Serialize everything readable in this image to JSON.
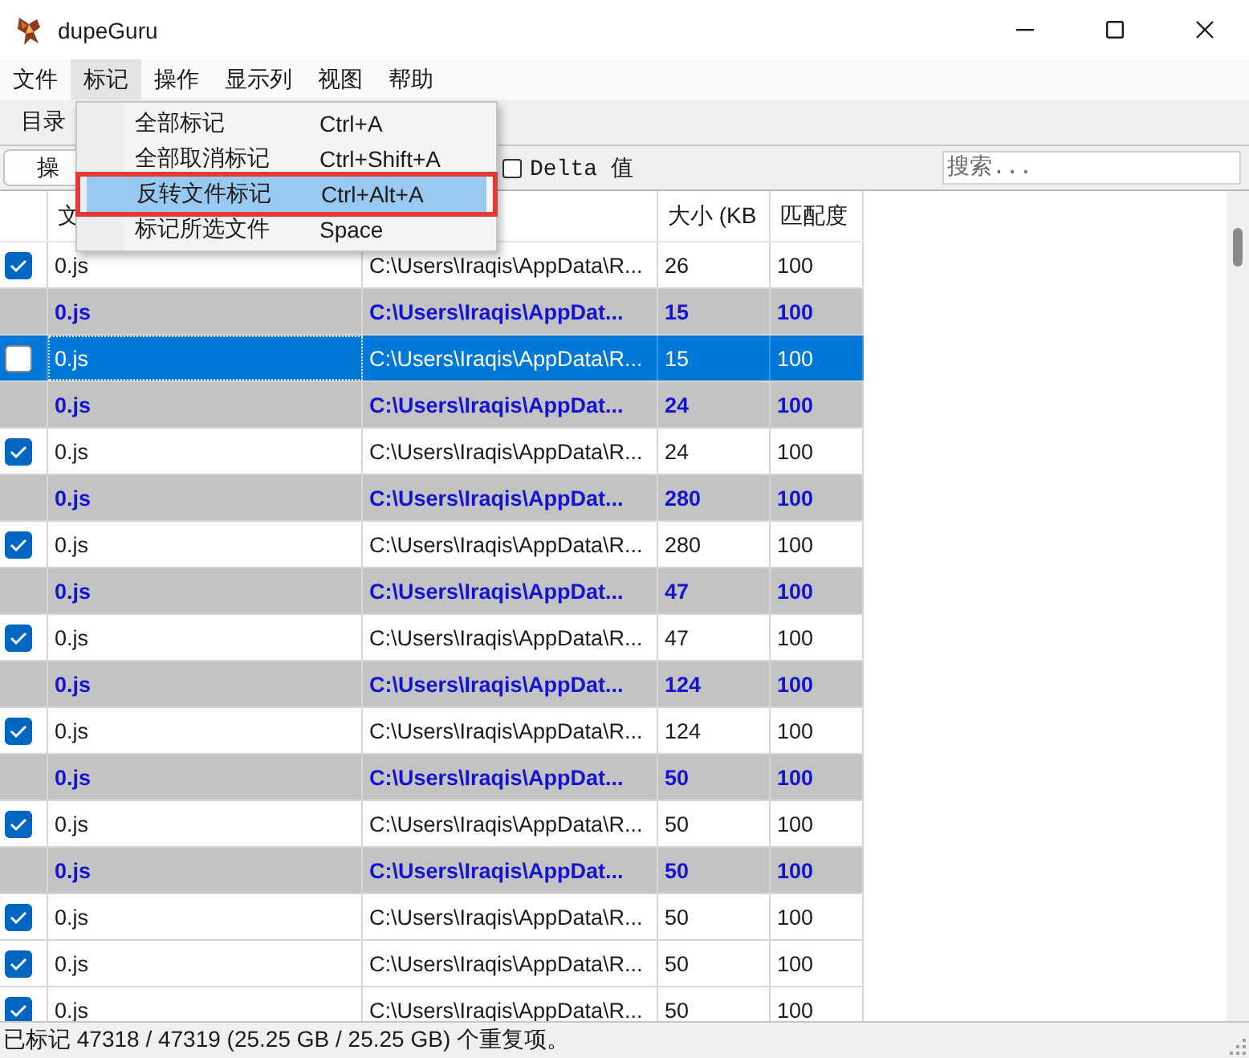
{
  "window": {
    "title": "dupeGuru"
  },
  "menu_bar": [
    {
      "label": "文件",
      "selected": false
    },
    {
      "label": "标记",
      "selected": true
    },
    {
      "label": "操作",
      "selected": false
    },
    {
      "label": "显示列",
      "selected": false
    },
    {
      "label": "视图",
      "selected": false
    },
    {
      "label": "帮助",
      "selected": false
    }
  ],
  "open_menu": {
    "items": [
      {
        "label": "全部标记",
        "shortcut": "Ctrl+A",
        "selected": false,
        "outlined": false
      },
      {
        "label": "全部取消标记",
        "shortcut": "Ctrl+Shift+A",
        "selected": false,
        "outlined": false
      },
      {
        "label": "反转文件标记",
        "shortcut": "Ctrl+Alt+A",
        "selected": true,
        "outlined": true
      },
      {
        "label": "标记所选文件",
        "shortcut": "Space",
        "selected": false,
        "outlined": false
      }
    ]
  },
  "toolbar": {
    "directories_button": "目录",
    "actions_button": "操",
    "delta_checkbox": {
      "label": "Delta 值",
      "checked": false
    },
    "search": {
      "placeholder": "搜索..."
    }
  },
  "table": {
    "columns": [
      "文",
      null,
      "大小 (KB",
      "匹配度"
    ],
    "rows": [
      {
        "kind": "duplicate",
        "checked": true,
        "selected": false,
        "filename": "0.js",
        "folder": "C:\\Users\\Iraqis\\AppData\\R...",
        "size": "26",
        "match": "100"
      },
      {
        "kind": "reference",
        "selected": false,
        "filename": "0.js",
        "folder": "C:\\Users\\Iraqis\\AppDat...",
        "size": "15",
        "match": "100"
      },
      {
        "kind": "duplicate",
        "checked": false,
        "selected": true,
        "filename": "0.js",
        "folder": "C:\\Users\\Iraqis\\AppData\\R...",
        "size": "15",
        "match": "100"
      },
      {
        "kind": "reference",
        "selected": false,
        "filename": "0.js",
        "folder": "C:\\Users\\Iraqis\\AppDat...",
        "size": "24",
        "match": "100"
      },
      {
        "kind": "duplicate",
        "checked": true,
        "selected": false,
        "filename": "0.js",
        "folder": "C:\\Users\\Iraqis\\AppData\\R...",
        "size": "24",
        "match": "100"
      },
      {
        "kind": "reference",
        "selected": false,
        "filename": "0.js",
        "folder": "C:\\Users\\Iraqis\\AppDat...",
        "size": "280",
        "match": "100"
      },
      {
        "kind": "duplicate",
        "checked": true,
        "selected": false,
        "filename": "0.js",
        "folder": "C:\\Users\\Iraqis\\AppData\\R...",
        "size": "280",
        "match": "100"
      },
      {
        "kind": "reference",
        "selected": false,
        "filename": "0.js",
        "folder": "C:\\Users\\Iraqis\\AppDat...",
        "size": "47",
        "match": "100"
      },
      {
        "kind": "duplicate",
        "checked": true,
        "selected": false,
        "filename": "0.js",
        "folder": "C:\\Users\\Iraqis\\AppData\\R...",
        "size": "47",
        "match": "100"
      },
      {
        "kind": "reference",
        "selected": false,
        "filename": "0.js",
        "folder": "C:\\Users\\Iraqis\\AppDat...",
        "size": "124",
        "match": "100"
      },
      {
        "kind": "duplicate",
        "checked": true,
        "selected": false,
        "filename": "0.js",
        "folder": "C:\\Users\\Iraqis\\AppData\\R...",
        "size": "124",
        "match": "100"
      },
      {
        "kind": "reference",
        "selected": false,
        "filename": "0.js",
        "folder": "C:\\Users\\Iraqis\\AppDat...",
        "size": "50",
        "match": "100"
      },
      {
        "kind": "duplicate",
        "checked": true,
        "selected": false,
        "filename": "0.js",
        "folder": "C:\\Users\\Iraqis\\AppData\\R...",
        "size": "50",
        "match": "100"
      },
      {
        "kind": "reference",
        "selected": false,
        "filename": "0.js",
        "folder": "C:\\Users\\Iraqis\\AppDat...",
        "size": "50",
        "match": "100"
      },
      {
        "kind": "duplicate",
        "checked": true,
        "selected": false,
        "filename": "0.js",
        "folder": "C:\\Users\\Iraqis\\AppData\\R...",
        "size": "50",
        "match": "100"
      },
      {
        "kind": "duplicate",
        "checked": true,
        "selected": false,
        "filename": "0.js",
        "folder": "C:\\Users\\Iraqis\\AppData\\R...",
        "size": "50",
        "match": "100"
      },
      {
        "kind": "duplicate",
        "checked": true,
        "selected": false,
        "filename": "0.js",
        "folder": "C:\\Users\\Iraqis\\AppData\\R...",
        "size": "50",
        "match": "100"
      }
    ]
  },
  "status_bar": "已标记 47318 / 47319 (25.25 GB / 25.25 GB) 个重复项。"
}
